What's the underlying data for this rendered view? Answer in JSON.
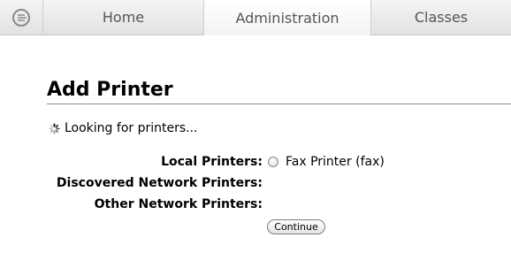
{
  "nav": {
    "logo_icon": "cups-logo-icon",
    "tabs": [
      {
        "label": "Home",
        "active": false
      },
      {
        "label": "Administration",
        "active": true
      },
      {
        "label": "Classes",
        "active": false
      }
    ]
  },
  "main": {
    "title": "Add Printer",
    "status": {
      "icon": "loading-spinner-icon",
      "text": "Looking for printers..."
    },
    "local_printers": {
      "label": "Local Printers:",
      "options": [
        {
          "label": "Fax Printer (fax)",
          "selected": false
        }
      ]
    },
    "discovered_network_printers": {
      "label": "Discovered Network Printers:"
    },
    "other_network_printers": {
      "label": "Other Network Printers:"
    },
    "continue_label": "Continue"
  }
}
